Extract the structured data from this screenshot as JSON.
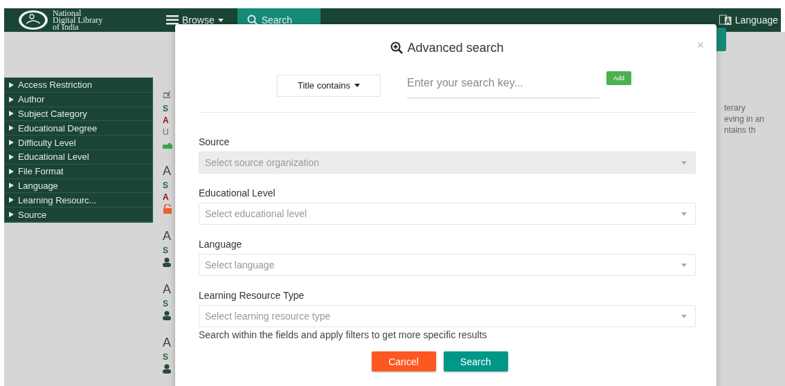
{
  "navbar": {
    "logo_lines": [
      "National",
      "Digital Library",
      "of India"
    ],
    "browse": {
      "label": "Browse",
      "expanded": false
    },
    "search_tab": {
      "label": "Search",
      "selected": true
    },
    "language": {
      "label": "Language"
    }
  },
  "facets": [
    {
      "label": "Access Restriction",
      "expanded": false
    },
    {
      "label": "Author",
      "expanded": false
    },
    {
      "label": "Subject Category",
      "expanded": false
    },
    {
      "label": "Educational Degree",
      "expanded": false
    },
    {
      "label": "Difficulty Level",
      "expanded": false
    },
    {
      "label": "Educational Level",
      "expanded": false
    },
    {
      "label": "File Format",
      "expanded": false
    },
    {
      "label": "Language",
      "expanded": false
    },
    {
      "label": "Learning Resourc...",
      "expanded": false
    },
    {
      "label": "Source",
      "expanded": false
    }
  ],
  "results": [
    {
      "title": "ಡ",
      "source": "S",
      "author": "A",
      "extra": "U",
      "kind": "open"
    },
    {
      "title": "A",
      "source": "S",
      "author": "A",
      "kind": "locked"
    },
    {
      "title": "A",
      "source": "S",
      "kind": "group"
    },
    {
      "title": "A",
      "source": "S",
      "kind": "group"
    },
    {
      "title": "A",
      "source": "S",
      "kind": "group"
    }
  ],
  "snippet_lines": [
    "terary",
    "eving in an",
    "ntains th"
  ],
  "dialog": {
    "title": "Advanced search",
    "close": "×",
    "search_row": {
      "field": "Title contains",
      "placeholder": "Enter your search key...",
      "add": "Add"
    },
    "fields": [
      {
        "label": "Source",
        "placeholder": "Select source organization",
        "disabled": true
      },
      {
        "label": "Educational Level",
        "placeholder": "Select educational level",
        "disabled": false
      },
      {
        "label": "Language",
        "placeholder": "Select language",
        "disabled": false
      },
      {
        "label": "Learning Resource Type",
        "placeholder": "Select learning resource type",
        "disabled": false
      }
    ],
    "help": "Search within the fields and apply filters to get more specific results",
    "buttons": [
      {
        "label": "Cancel",
        "kind": "cancel"
      },
      {
        "label": "Search",
        "kind": "submit"
      }
    ]
  }
}
